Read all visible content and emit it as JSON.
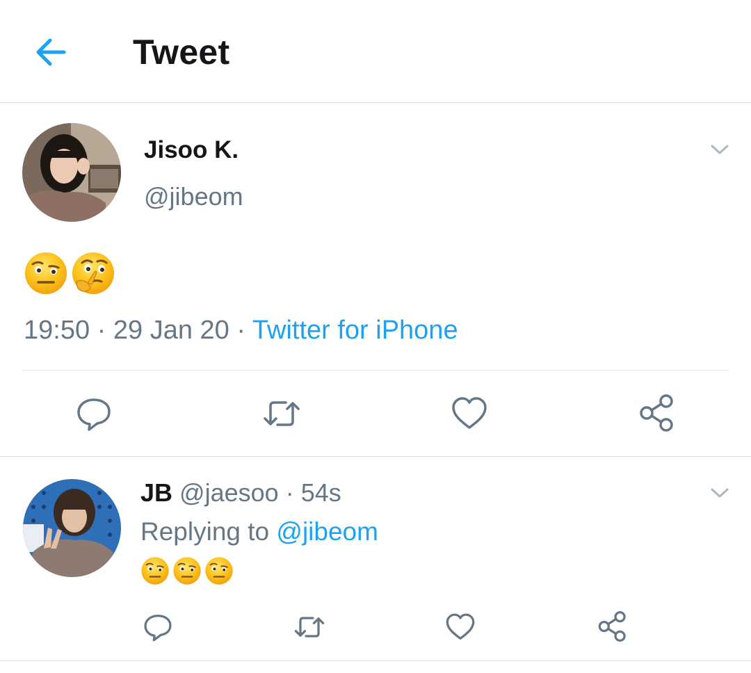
{
  "header": {
    "title": "Tweet",
    "back_icon": "arrow-left-icon",
    "accent": "#1da1f2"
  },
  "tweet": {
    "author_name": "Jisoo K.",
    "author_handle": "@jibeom",
    "emojis": [
      "raised-eyebrow-emoji",
      "thinking-face-emoji"
    ],
    "time": "19:50",
    "separator": "·",
    "date": "29 Jan 20",
    "source": "Twitter for iPhone",
    "actions": [
      "reply-icon",
      "retweet-icon",
      "like-icon",
      "share-icon"
    ]
  },
  "reply": {
    "author_name": "JB",
    "author_handle": "@jaesoo",
    "separator": "·",
    "age": "54s",
    "replying_to_label": "Replying to",
    "replying_to_handle": "@jibeom",
    "emojis": [
      "raised-eyebrow-emoji",
      "raised-eyebrow-emoji",
      "raised-eyebrow-emoji"
    ],
    "actions": [
      "reply-icon",
      "retweet-icon",
      "like-icon",
      "share-icon"
    ]
  },
  "colors": {
    "text_primary": "#14171a",
    "text_secondary": "#657786",
    "link": "#1da1f2",
    "icon": "#657786",
    "divider": "#e1e8ed"
  }
}
